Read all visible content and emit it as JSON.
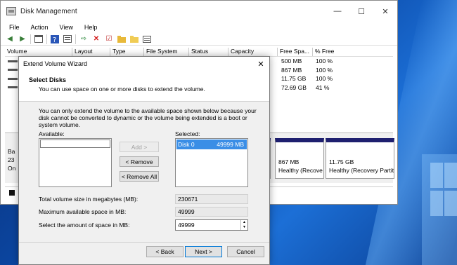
{
  "main_window": {
    "title": "Disk Management",
    "controls": {
      "minimize": "—",
      "maximize": "☐",
      "close": "✕"
    },
    "menu": [
      "File",
      "Action",
      "View",
      "Help"
    ],
    "columns": [
      "Volume",
      "Layout",
      "Type",
      "File System",
      "Status",
      "Capacity",
      "Free Spa...",
      "% Free"
    ],
    "volumes": [
      {
        "free": "500 MB",
        "pct": "100 %"
      },
      {
        "free": "867 MB",
        "pct": "100 %"
      },
      {
        "free": "11.75 GB",
        "pct": "100 %"
      },
      {
        "free": "72.69 GB",
        "pct": "41 %"
      }
    ],
    "disk_label_lines": [
      "Ba",
      "23",
      "On"
    ],
    "partitions": [
      {
        "size": "867 MB",
        "status": "Healthy (Recove"
      },
      {
        "size": "11.75 GB",
        "status": "Healthy (Recovery Partit"
      }
    ]
  },
  "wizard": {
    "title": "Extend Volume Wizard",
    "close": "✕",
    "heading": "Select Disks",
    "subheading": "You can use space on one or more disks to extend the volume.",
    "description": "You can only extend the volume to the available space shown below because your disk cannot be converted to dynamic or the volume being extended is a boot or system volume.",
    "available_label": "Available:",
    "selected_label": "Selected:",
    "selected_items": [
      {
        "disk": "Disk 0",
        "size": "49999 MB"
      }
    ],
    "buttons": {
      "add": "Add >",
      "remove": "< Remove",
      "remove_all": "< Remove All",
      "back": "< Back",
      "next": "Next >",
      "cancel": "Cancel"
    },
    "fields": {
      "total_label": "Total volume size in megabytes (MB):",
      "total_value": "230671",
      "max_label": "Maximum available space in MB:",
      "max_value": "49999",
      "amount_label": "Select the amount of space in MB:",
      "amount_value": "49999"
    }
  }
}
